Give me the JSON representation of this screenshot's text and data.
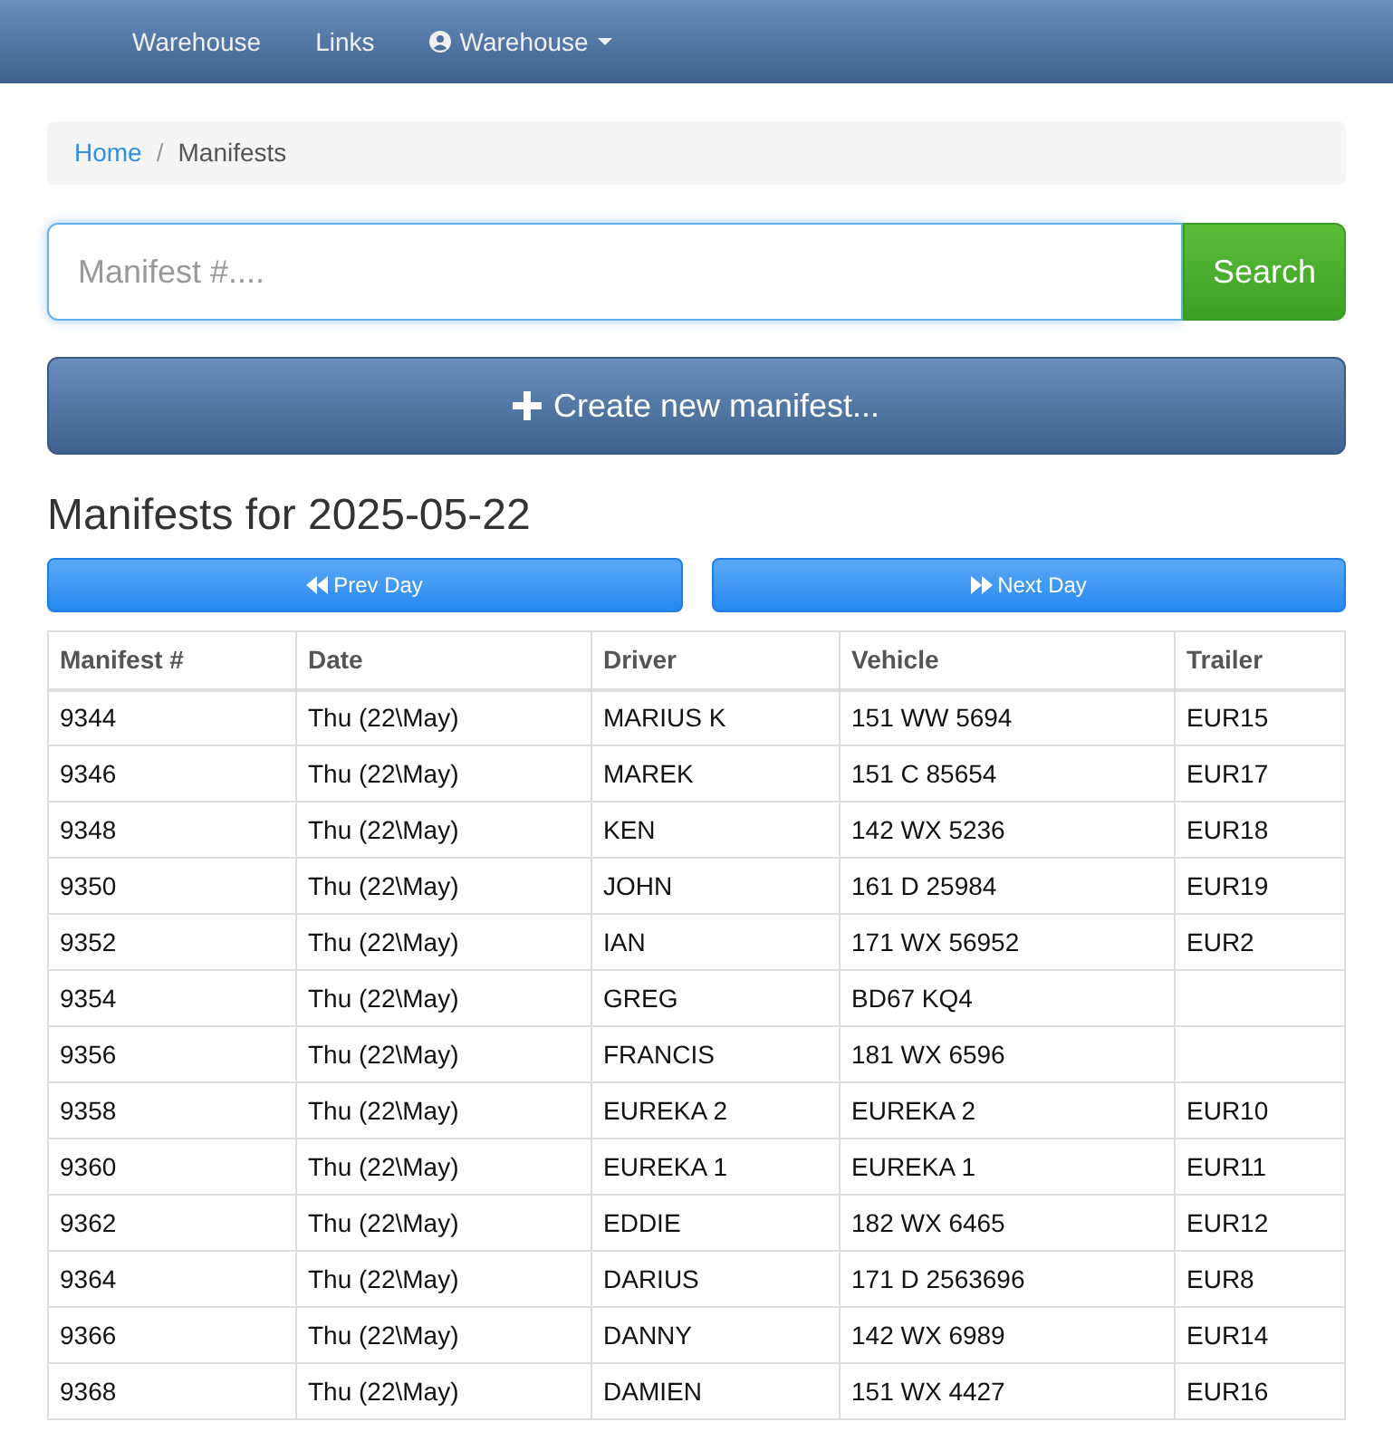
{
  "navbar": {
    "items": [
      {
        "label": "Warehouse",
        "kind": "link"
      },
      {
        "label": "Links",
        "kind": "link"
      },
      {
        "label": "Warehouse",
        "kind": "user_dropdown"
      }
    ]
  },
  "breadcrumb": [
    {
      "label": "Home",
      "kind": "link"
    },
    {
      "label": "/",
      "kind": "separator"
    },
    {
      "label": "Manifests",
      "kind": "current"
    }
  ],
  "search": {
    "placeholder": "Manifest #....",
    "button": "Search"
  },
  "create_button": "Create new manifest...",
  "heading": "Manifests for 2025-05-22",
  "day_buttons": [
    {
      "label": "Prev Day",
      "kind": "prev"
    },
    {
      "label": "Next Day",
      "kind": "next"
    }
  ],
  "table": {
    "columns": [
      "Manifest #",
      "Date",
      "Driver",
      "Vehicle",
      "Trailer"
    ],
    "rows": [
      [
        "9344",
        "Thu (22\\May)",
        "MARIUS K",
        "151 WW 5694",
        "EUR15"
      ],
      [
        "9346",
        "Thu (22\\May)",
        "MAREK",
        "151 C 85654",
        "EUR17"
      ],
      [
        "9348",
        "Thu (22\\May)",
        "KEN",
        "142 WX 5236",
        "EUR18"
      ],
      [
        "9350",
        "Thu (22\\May)",
        "JOHN",
        "161 D 25984",
        "EUR19"
      ],
      [
        "9352",
        "Thu (22\\May)",
        "IAN",
        "171 WX 56952",
        "EUR2"
      ],
      [
        "9354",
        "Thu (22\\May)",
        "GREG",
        "BD67 KQ4"
      ],
      [
        "9356",
        "Thu (22\\May)",
        "FRANCIS",
        "181 WX 6596"
      ],
      [
        "9358",
        "Thu (22\\May)",
        "EUREKA 2",
        "EUREKA 2",
        "EUR10"
      ],
      [
        "9360",
        "Thu (22\\May)",
        "EUREKA 1",
        "EUREKA 1",
        "EUR11"
      ],
      [
        "9362",
        "Thu (22\\May)",
        "EDDIE",
        "182 WX 6465",
        "EUR12"
      ],
      [
        "9364",
        "Thu (22\\May)",
        "DARIUS",
        "171 D 2563696",
        "EUR8"
      ],
      [
        "9366",
        "Thu (22\\May)",
        "DANNY",
        "142 WX 6989",
        "EUR14"
      ],
      [
        "9368",
        "Thu (22\\May)",
        "DAMIEN",
        "151 WX 4427",
        "EUR16"
      ]
    ]
  }
}
